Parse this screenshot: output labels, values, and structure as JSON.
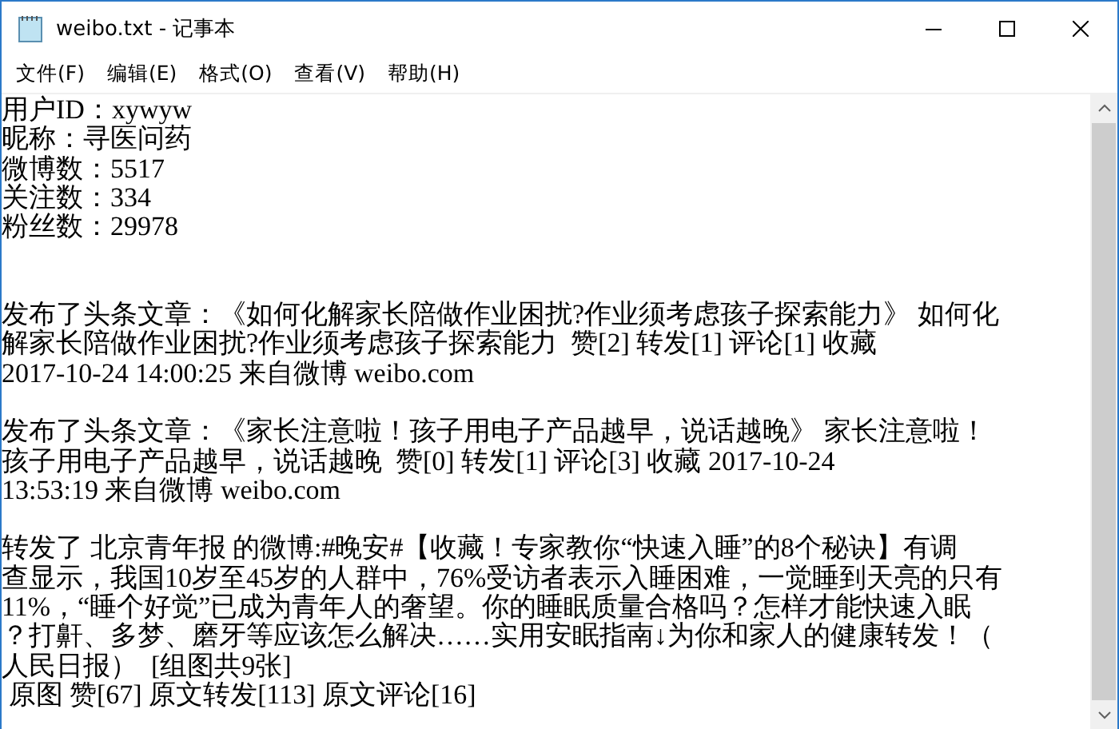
{
  "window": {
    "title": "weibo.txt - 记事本"
  },
  "menu": [
    "文件(F)",
    "编辑(E)",
    "格式(O)",
    "查看(V)",
    "帮助(H)"
  ],
  "document": {
    "blocks": [
      {
        "kind": "profile",
        "lines": [
          "用户ID：xywyw",
          "昵称：寻医问药",
          "微博数：5517",
          "关注数：334",
          "粉丝数：29978"
        ]
      },
      {
        "kind": "post",
        "lines": [
          "发布了头条文章：《如何化解家长陪做作业困扰?作业须考虑孩子探索能力》 如何化",
          "解家长陪做作业困扰?作业须考虑孩子探索能力  赞[2] 转发[1] 评论[1] 收藏",
          "2017-10-24 14:00:25 来自微博 weibo.com"
        ]
      },
      {
        "kind": "post",
        "lines": [
          "发布了头条文章：《家长注意啦！孩子用电子产品越早，说话越晚》 家长注意啦！",
          "孩子用电子产品越早，说话越晚  赞[0] 转发[1] 评论[3] 收藏 2017-10-24",
          "13:53:19 来自微博 weibo.com"
        ]
      },
      {
        "kind": "post",
        "lines": [
          "转发了 北京青年报 的微博:#晚安#【收藏！专家教你“快速入睡”的8个秘诀】有调",
          "查显示，我国10岁至45岁的人群中，76%受访者表示入睡困难，一觉睡到天亮的只有",
          "11%，“睡个好觉”已成为青年人的奢望。你的睡眠质量合格吗？怎样才能快速入眠",
          "？打鼾、多梦、磨牙等应该怎么解决……实用安眠指南↓为你和家人的健康转发！（",
          "人民日报）  [组图共9张]",
          " 原图 赞[67] 原文转发[113] 原文评论[16]"
        ]
      }
    ]
  }
}
